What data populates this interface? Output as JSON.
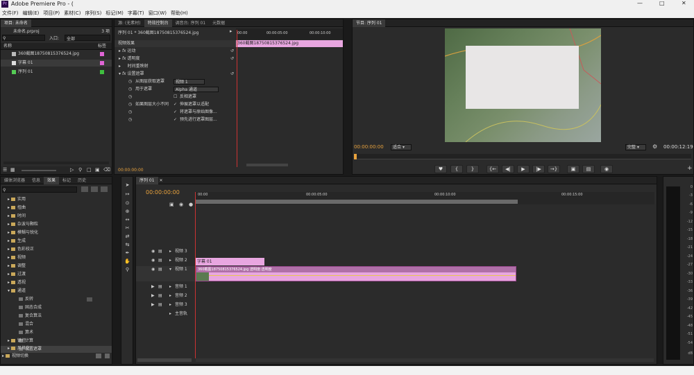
{
  "window": {
    "app_icon": "Pr",
    "title": "Adobe Premiere Pro - ("
  },
  "menu": [
    "文件(F)",
    "编辑(E)",
    "项目(P)",
    "素材(C)",
    "序列(S)",
    "标记(M)",
    "字幕(T)",
    "窗口(W)",
    "帮助(H)"
  ],
  "project": {
    "tab_label": "项目: 未命名",
    "file_name": "未命名.prproj",
    "item_count": "3 项",
    "search_placeholder": "",
    "input_label": "入口:",
    "input_value": "全部",
    "col_name": "名称",
    "col_label": "标签",
    "items": [
      {
        "name": "360截图18750815376524.jpg",
        "color": "#e065d6",
        "icon": "image-icon"
      },
      {
        "name": "字幕 01",
        "color": "#e065d6",
        "icon": "title-icon"
      },
      {
        "name": "序列 01",
        "color": "#3fbf3f",
        "icon": "sequence-icon"
      }
    ]
  },
  "effect_controls": {
    "tabs": [
      "源: (无素材)",
      "特效控制台",
      "调音台: 序列 01",
      "元数据"
    ],
    "header": "序列 01 * 360截图18750815376524.jpg",
    "ruler": [
      "00:00",
      "00:00:05:00",
      "00:00:10:00"
    ],
    "clip_label": "360截图18750815376524.jpg",
    "section": "视频效果",
    "effects": [
      "运动",
      "透明度",
      "时间重映射",
      "设置遮罩"
    ],
    "params": [
      {
        "label": "从图层获取遮罩",
        "value": "视频 1"
      },
      {
        "label": "用于遮罩",
        "value": "Alpha 通道"
      },
      {
        "label": "",
        "value": "反相遮罩",
        "checked": false
      },
      {
        "label": "如果图层大小不同",
        "value": "伸展遮罩以适配",
        "checked": true
      },
      {
        "label": "",
        "value": "将遮罩与原始图像...",
        "checked": true
      },
      {
        "label": "",
        "value": "预先进行遮罩图层...",
        "checked": true
      }
    ],
    "timecode": "00:00:00:00"
  },
  "program": {
    "tab": "节目: 序列 01",
    "timecode_left": "00:00:00:00",
    "fit": "适合",
    "quality": "完整",
    "timecode_right": "00:00:12:19"
  },
  "effects_panel": {
    "tabs": [
      "媒体浏览器",
      "信息",
      "效果",
      "标记",
      "历史"
    ],
    "folders": [
      "实用",
      "扭曲",
      "时间",
      "杂波与颗粒",
      "模糊与锐化",
      "生成",
      "色彩校正",
      "视频",
      "调整",
      "过渡",
      "透视",
      "通道"
    ],
    "channel_items": [
      "反转",
      "固态合成",
      "复合算法",
      "混合",
      "算术",
      "计算",
      "设置遮罩"
    ],
    "more_folders": [
      "键控",
      "风格化"
    ],
    "last": "视频切换"
  },
  "timeline": {
    "tab": "序列 01",
    "timecode": "00:00:00:00",
    "ruler": [
      "00:00",
      "00:00:05:00",
      "00:00:10:00",
      "00:00:15:00"
    ],
    "tracks": [
      {
        "name": "视频 3"
      },
      {
        "name": "视频 2"
      },
      {
        "name": "视频 1"
      },
      {
        "name": "音频 1"
      },
      {
        "name": "音频 2"
      },
      {
        "name": "音频 3"
      },
      {
        "name": "主音轨"
      }
    ],
    "title_clip": "字幕 01",
    "image_clip": "360截图18750815376524.jpg 透明度:透明度"
  },
  "meter": {
    "labels": [
      "0",
      "-3",
      "-6",
      "-9",
      "-12",
      "-15",
      "-18",
      "-21",
      "-24",
      "-27",
      "-30",
      "-33",
      "-36",
      "-39",
      "-42",
      "-45",
      "-48",
      "-51",
      "-54",
      "dB"
    ]
  }
}
